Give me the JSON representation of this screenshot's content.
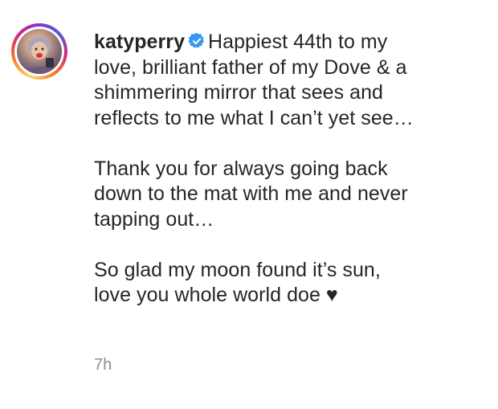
{
  "post": {
    "username": "katyperry",
    "verified_icon": "verified-badge-icon",
    "caption_paragraphs": [
      "Happiest 44th to my\nlove, brilliant father of my Dove & a\nshimmering mirror that sees and\nreflects to me what I can’t yet see…",
      "Thank you for always going back\ndown to the mat with me and never\ntapping out…",
      "So glad my moon found it’s sun,\nlove you whole world doe ♥"
    ],
    "timestamp": "7h"
  },
  "colors": {
    "text": "#262626",
    "muted": "#8e8e8e",
    "verified": "#3897f0"
  }
}
